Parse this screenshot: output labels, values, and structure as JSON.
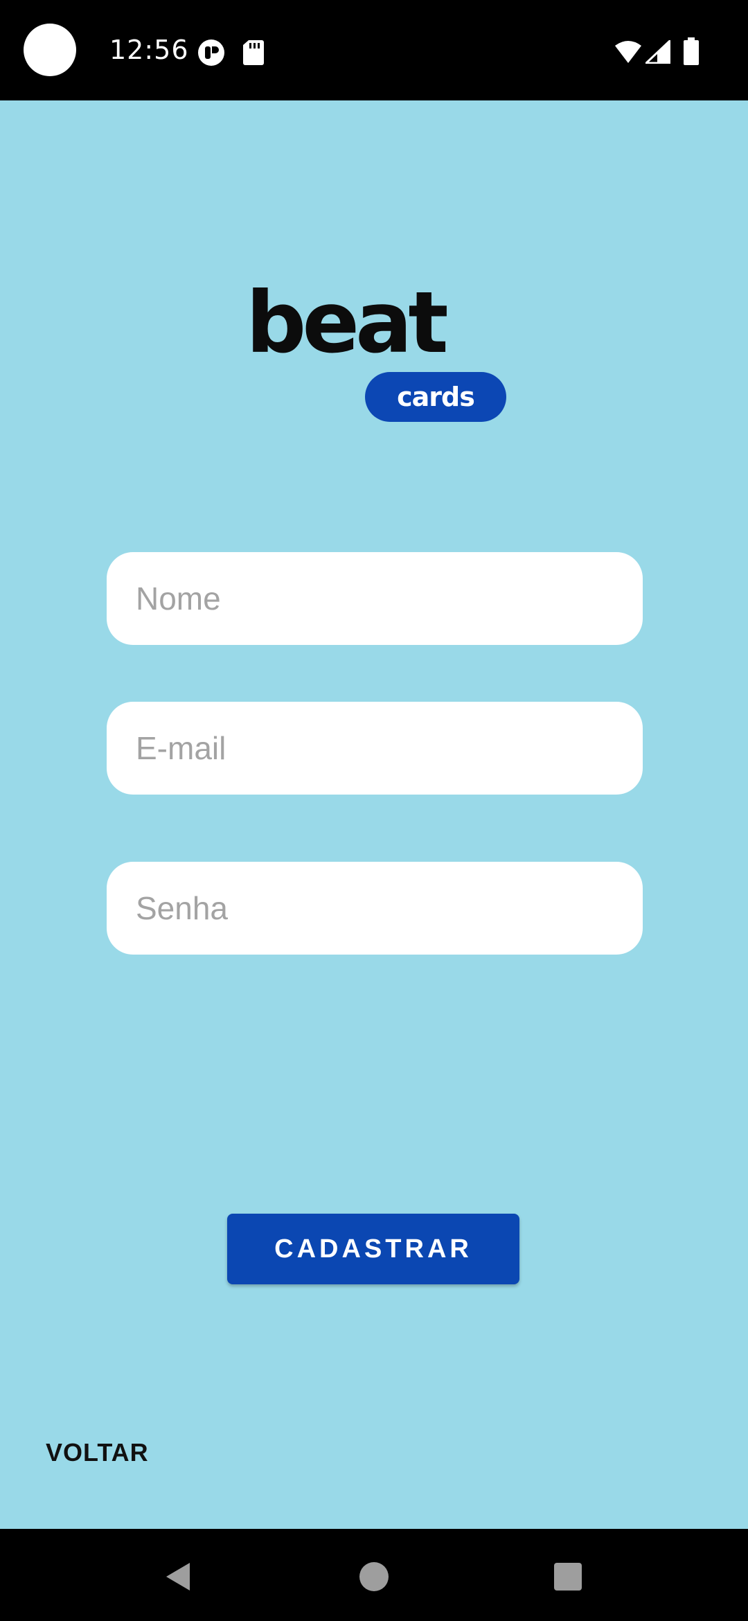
{
  "status_bar": {
    "time": "12:56",
    "left_icons": [
      "camera-dot",
      "privacy-indicator-icon",
      "sd-card-icon"
    ],
    "right_icons": [
      "wifi-icon",
      "signal-icon",
      "battery-icon"
    ]
  },
  "logo": {
    "word": "beat",
    "pill": "cards",
    "pill_color": "#0C47B4"
  },
  "form": {
    "name_placeholder": "Nome",
    "email_placeholder": "E-mail",
    "password_placeholder": "Senha"
  },
  "actions": {
    "submit_label": "CADASTRAR",
    "back_label": "VOLTAR"
  },
  "colors": {
    "background": "#99D9E8",
    "primary": "#0B47B2"
  },
  "nav_bar": {
    "buttons": [
      "back-icon",
      "home-icon",
      "recents-icon"
    ]
  }
}
